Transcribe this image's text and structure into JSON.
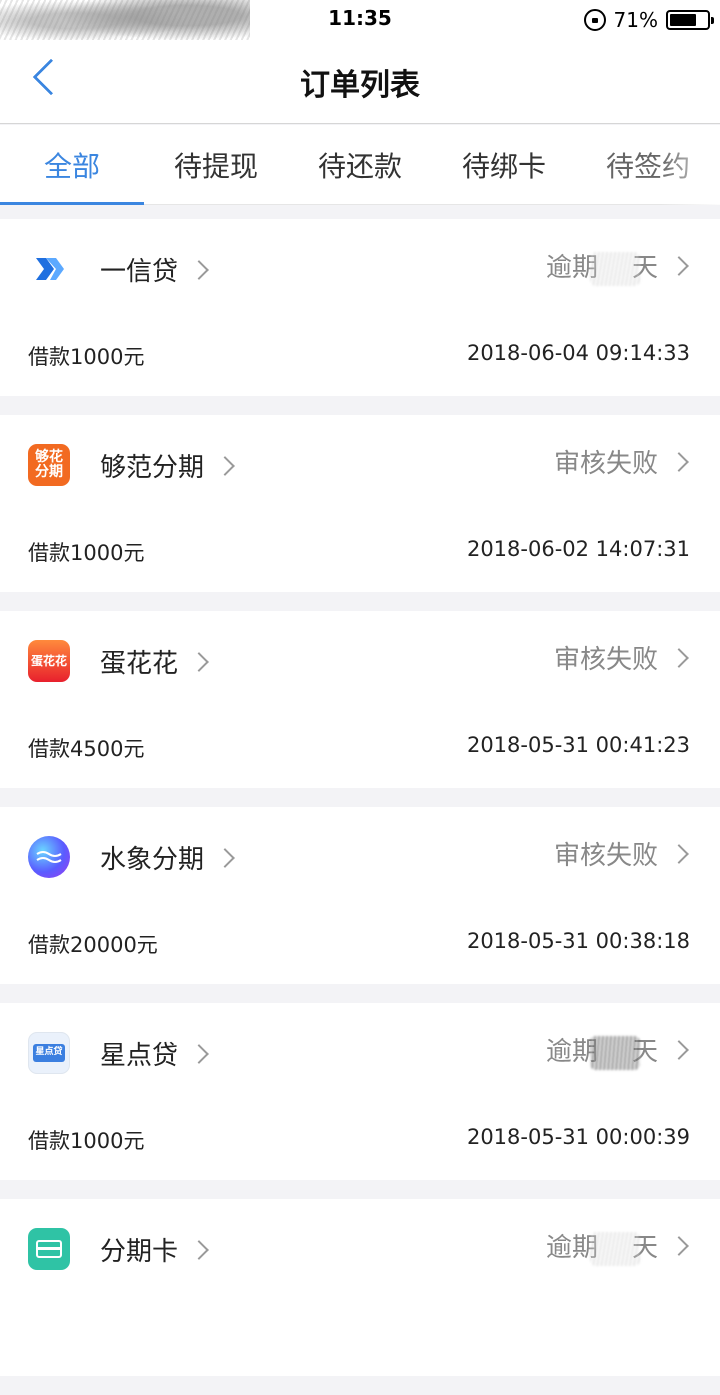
{
  "status_bar": {
    "time": "11:35",
    "battery_percent": "71%",
    "battery_level": 0.71
  },
  "nav": {
    "title": "订单列表"
  },
  "tabs": [
    {
      "label": "全部",
      "active": true
    },
    {
      "label": "待提现",
      "active": false
    },
    {
      "label": "待还款",
      "active": false
    },
    {
      "label": "待绑卡",
      "active": false
    },
    {
      "label": "待签约",
      "active": false
    }
  ],
  "orders": [
    {
      "name": "一信贷",
      "status_prefix": "逾期",
      "status_suffix": "天",
      "amount": "借款1000元",
      "time": "2018-06-04 09:14:33",
      "logo_icon": "yixindai-logo-icon"
    },
    {
      "name": "够范分期",
      "status": "审核失败",
      "amount": "借款1000元",
      "time": "2018-06-02 14:07:31",
      "logo_icon": "goufan-logo-icon",
      "logo_text": "够花分期"
    },
    {
      "name": "蛋花花",
      "status": "审核失败",
      "amount": "借款4500元",
      "time": "2018-05-31 00:41:23",
      "logo_icon": "danhuahua-logo-icon",
      "logo_text": "蛋花花"
    },
    {
      "name": "水象分期",
      "status": "审核失败",
      "amount": "借款20000元",
      "time": "2018-05-31 00:38:18",
      "logo_icon": "shuixiang-logo-icon"
    },
    {
      "name": "星点贷",
      "status_prefix": "逾期",
      "status_suffix": "天",
      "amount": "借款1000元",
      "time": "2018-05-31 00:00:39",
      "logo_icon": "xingdiandai-logo-icon",
      "logo_text": "星点贷"
    },
    {
      "name": "分期卡",
      "status_prefix": "逾期",
      "status_suffix": "天",
      "logo_icon": "fenqika-logo-icon"
    }
  ],
  "colors": {
    "accent": "#3b86e0",
    "background": "#f3f3f6",
    "status_gray": "#888888"
  }
}
